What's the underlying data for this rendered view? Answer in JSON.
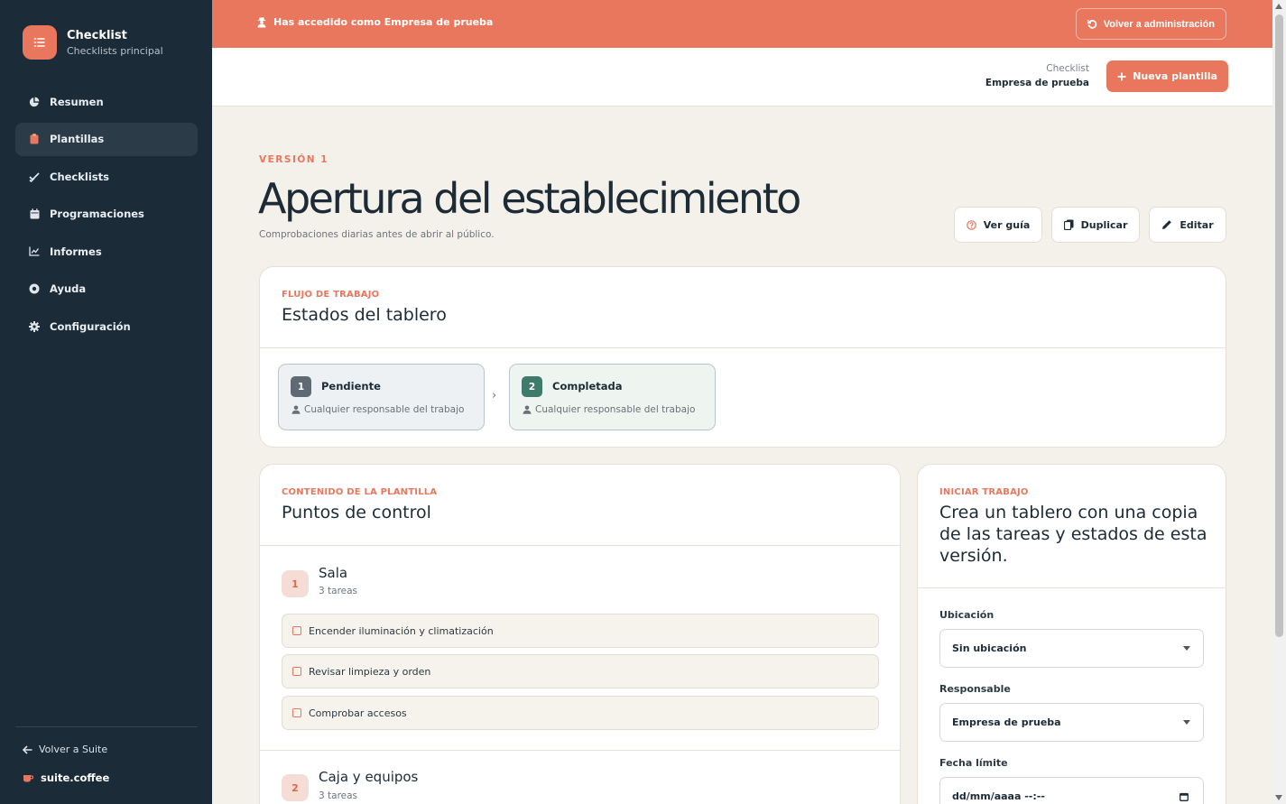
{
  "sidebar": {
    "brand_title": "Checklist",
    "brand_subtitle": "Checklists principal",
    "items": [
      {
        "label": "Resumen",
        "icon": "pie-chart-icon"
      },
      {
        "label": "Plantillas",
        "icon": "clipboard-icon",
        "active": true
      },
      {
        "label": "Checklists",
        "icon": "double-check-icon"
      },
      {
        "label": "Programaciones",
        "icon": "calendar-icon"
      },
      {
        "label": "Informes",
        "icon": "line-chart-icon"
      },
      {
        "label": "Ayuda",
        "icon": "help-circle-icon"
      },
      {
        "label": "Configuración",
        "icon": "gear-icon"
      }
    ],
    "back_label": "Volver a Suite",
    "suite_label": "suite.coffee"
  },
  "banner": {
    "text": "Has accedido como Empresa de prueba",
    "button_label": "Volver a administración"
  },
  "header": {
    "app_label": "Checklist",
    "company": "Empresa de prueba",
    "new_button_label": "Nueva plantilla"
  },
  "page": {
    "version_label": "VERSIÓN 1",
    "title": "Apertura del establecimiento",
    "subtitle": "Comprobaciones diarias antes de abrir al público.",
    "actions": {
      "guide": "Ver guía",
      "duplicate": "Duplicar",
      "edit": "Editar"
    }
  },
  "workflow": {
    "eyebrow": "FLUJO DE TRABAJO",
    "title": "Estados del tablero",
    "states": [
      {
        "number": "1",
        "name": "Pendiente",
        "responsible": "Cualquier responsable del trabajo",
        "color": "#5f6b74"
      },
      {
        "number": "2",
        "name": "Completada",
        "responsible": "Cualquier responsable del trabajo",
        "color": "#3f7b6a"
      }
    ]
  },
  "content": {
    "eyebrow": "CONTENIDO DE LA PLANTILLA",
    "title": "Puntos de control",
    "sections": [
      {
        "number": "1",
        "name": "Sala",
        "count": "3 tareas",
        "tasks": [
          "Encender iluminación y climatización",
          "Revisar limpieza y orden",
          "Comprobar accesos"
        ]
      },
      {
        "number": "2",
        "name": "Caja y equipos",
        "count": "3 tareas",
        "tasks": []
      }
    ]
  },
  "start": {
    "eyebrow": "INICIAR TRABAJO",
    "title": "Crea un tablero con una copia de las tareas y estados de esta versión.",
    "location_label": "Ubicación",
    "location_value": "Sin ubicación",
    "responsible_label": "Responsable",
    "responsible_value": "Empresa de prueba",
    "due_label": "Fecha límite",
    "due_placeholder": "dd/mm/aaaa --:--"
  },
  "colors": {
    "accent": "#e8775e",
    "sidebar": "#1b2b38",
    "background": "#f4f0ea"
  }
}
